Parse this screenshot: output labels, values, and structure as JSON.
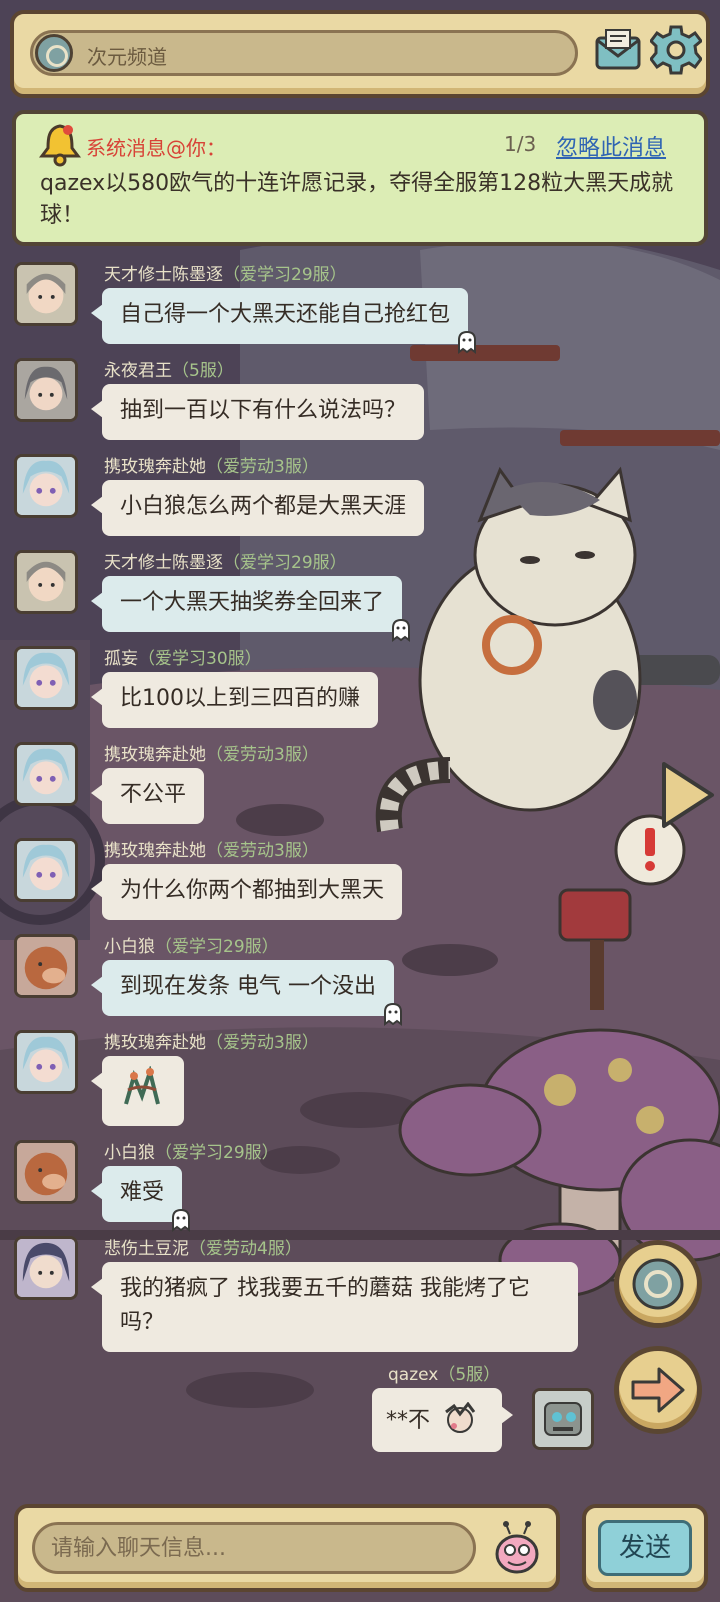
{
  "header": {
    "channel_name": "次元频道",
    "mail_icon": "mail-icon",
    "settings_icon": "gear-icon"
  },
  "system_message": {
    "title": "系统消息@你：",
    "counter": "1/3",
    "ignore_label": "忽略此消息",
    "body": "qazex以580欧气的十连许愿记录，夺得全服第128粒大黑天成就球！"
  },
  "messages": [
    {
      "name": "天才修士陈墨逐",
      "server": "（爱学习29服）",
      "text": "自己得一个大黑天还能自己抢红包",
      "style": "blue"
    },
    {
      "name": "永夜君王",
      "server": "（5服）",
      "text": "抽到一百以下有什么说法吗？",
      "style": "plain"
    },
    {
      "name": "携玫瑰奔赴她",
      "server": "（爱劳动3服）",
      "text": "小白狼怎么两个都是大黑天涯",
      "style": "plain"
    },
    {
      "name": "天才修士陈墨逐",
      "server": "（爱学习29服）",
      "text": "一个大黑天抽奖券全回来了",
      "style": "blue"
    },
    {
      "name": "孤妄",
      "server": "（爱学习30服）",
      "text": "比100以上到三四百的赚",
      "style": "plain"
    },
    {
      "name": "携玫瑰奔赴她",
      "server": "（爱劳动3服）",
      "text": "不公平",
      "style": "plain"
    },
    {
      "name": "携玫瑰奔赴她",
      "server": "（爱劳动3服）",
      "text": "为什么你两个都抽到大黑天",
      "style": "plain"
    },
    {
      "name": "小白狼",
      "server": "（爱学习29服）",
      "text": "到现在发条  电气  一个没出",
      "style": "blue"
    },
    {
      "name": "携玫瑰奔赴她",
      "server": "（爱劳动3服）",
      "text": "",
      "style": "plain"
    },
    {
      "name": "小白狼",
      "server": "（爱学习29服）",
      "text": "难受",
      "style": "blue"
    },
    {
      "name": "悲伤土豆泥",
      "server": "（爱劳动4服）",
      "text": "我的猪疯了  找我要五千的蘑菇  我能烤了它吗？",
      "style": "plain"
    }
  ],
  "own_message": {
    "name": "qazex",
    "server": "（5服）",
    "text": "**不"
  },
  "input": {
    "placeholder": "请输入聊天信息...",
    "send_label": "发送"
  }
}
